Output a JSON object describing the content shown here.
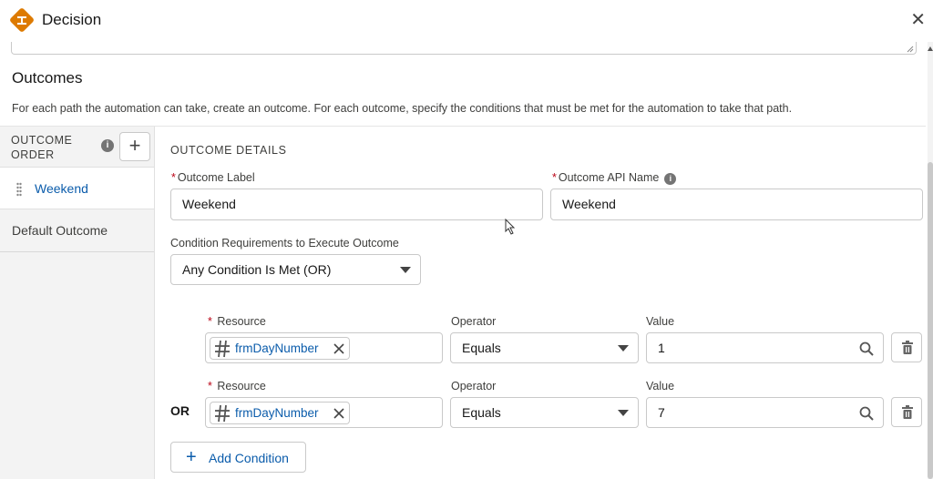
{
  "header": {
    "title": "Decision",
    "close_icon": "close-icon",
    "icon": "decision-icon",
    "icon_color": "#dd7a01"
  },
  "section": {
    "title": "Outcomes",
    "description": "For each path the automation can take, create an outcome. For each outcome, specify the conditions that must be met for the automation to take that path."
  },
  "sidebar": {
    "heading": "OUTCOME ORDER",
    "info": "i",
    "add": "+",
    "items": [
      {
        "label": "Weekend",
        "selected": true
      },
      {
        "label": "Default Outcome",
        "selected": false
      }
    ]
  },
  "details": {
    "title": "OUTCOME DETAILS",
    "outcome_label_label": "Outcome Label",
    "outcome_label_value": "Weekend",
    "api_name_label": "Outcome API Name",
    "api_name_value": "Weekend",
    "cond_req_label": "Condition Requirements to Execute Outcome",
    "cond_req_value": "Any Condition Is Met (OR)"
  },
  "conditions": [
    {
      "resource_label": "Resource",
      "resource": "frmDayNumber",
      "operator_label": "Operator",
      "operator": "Equals",
      "value_label": "Value",
      "value": "1"
    },
    {
      "resource_label": "Resource",
      "resource": "frmDayNumber",
      "operator_label": "Operator",
      "operator": "Equals",
      "value_label": "Value",
      "value": "7"
    }
  ],
  "or_label": "OR",
  "add_condition": {
    "plus": "+",
    "label": "Add Condition"
  },
  "required_mark": "*",
  "colors": {
    "link": "#0b5cab",
    "required": "#ba0517",
    "sidebar_bg": "#f3f3f3"
  }
}
